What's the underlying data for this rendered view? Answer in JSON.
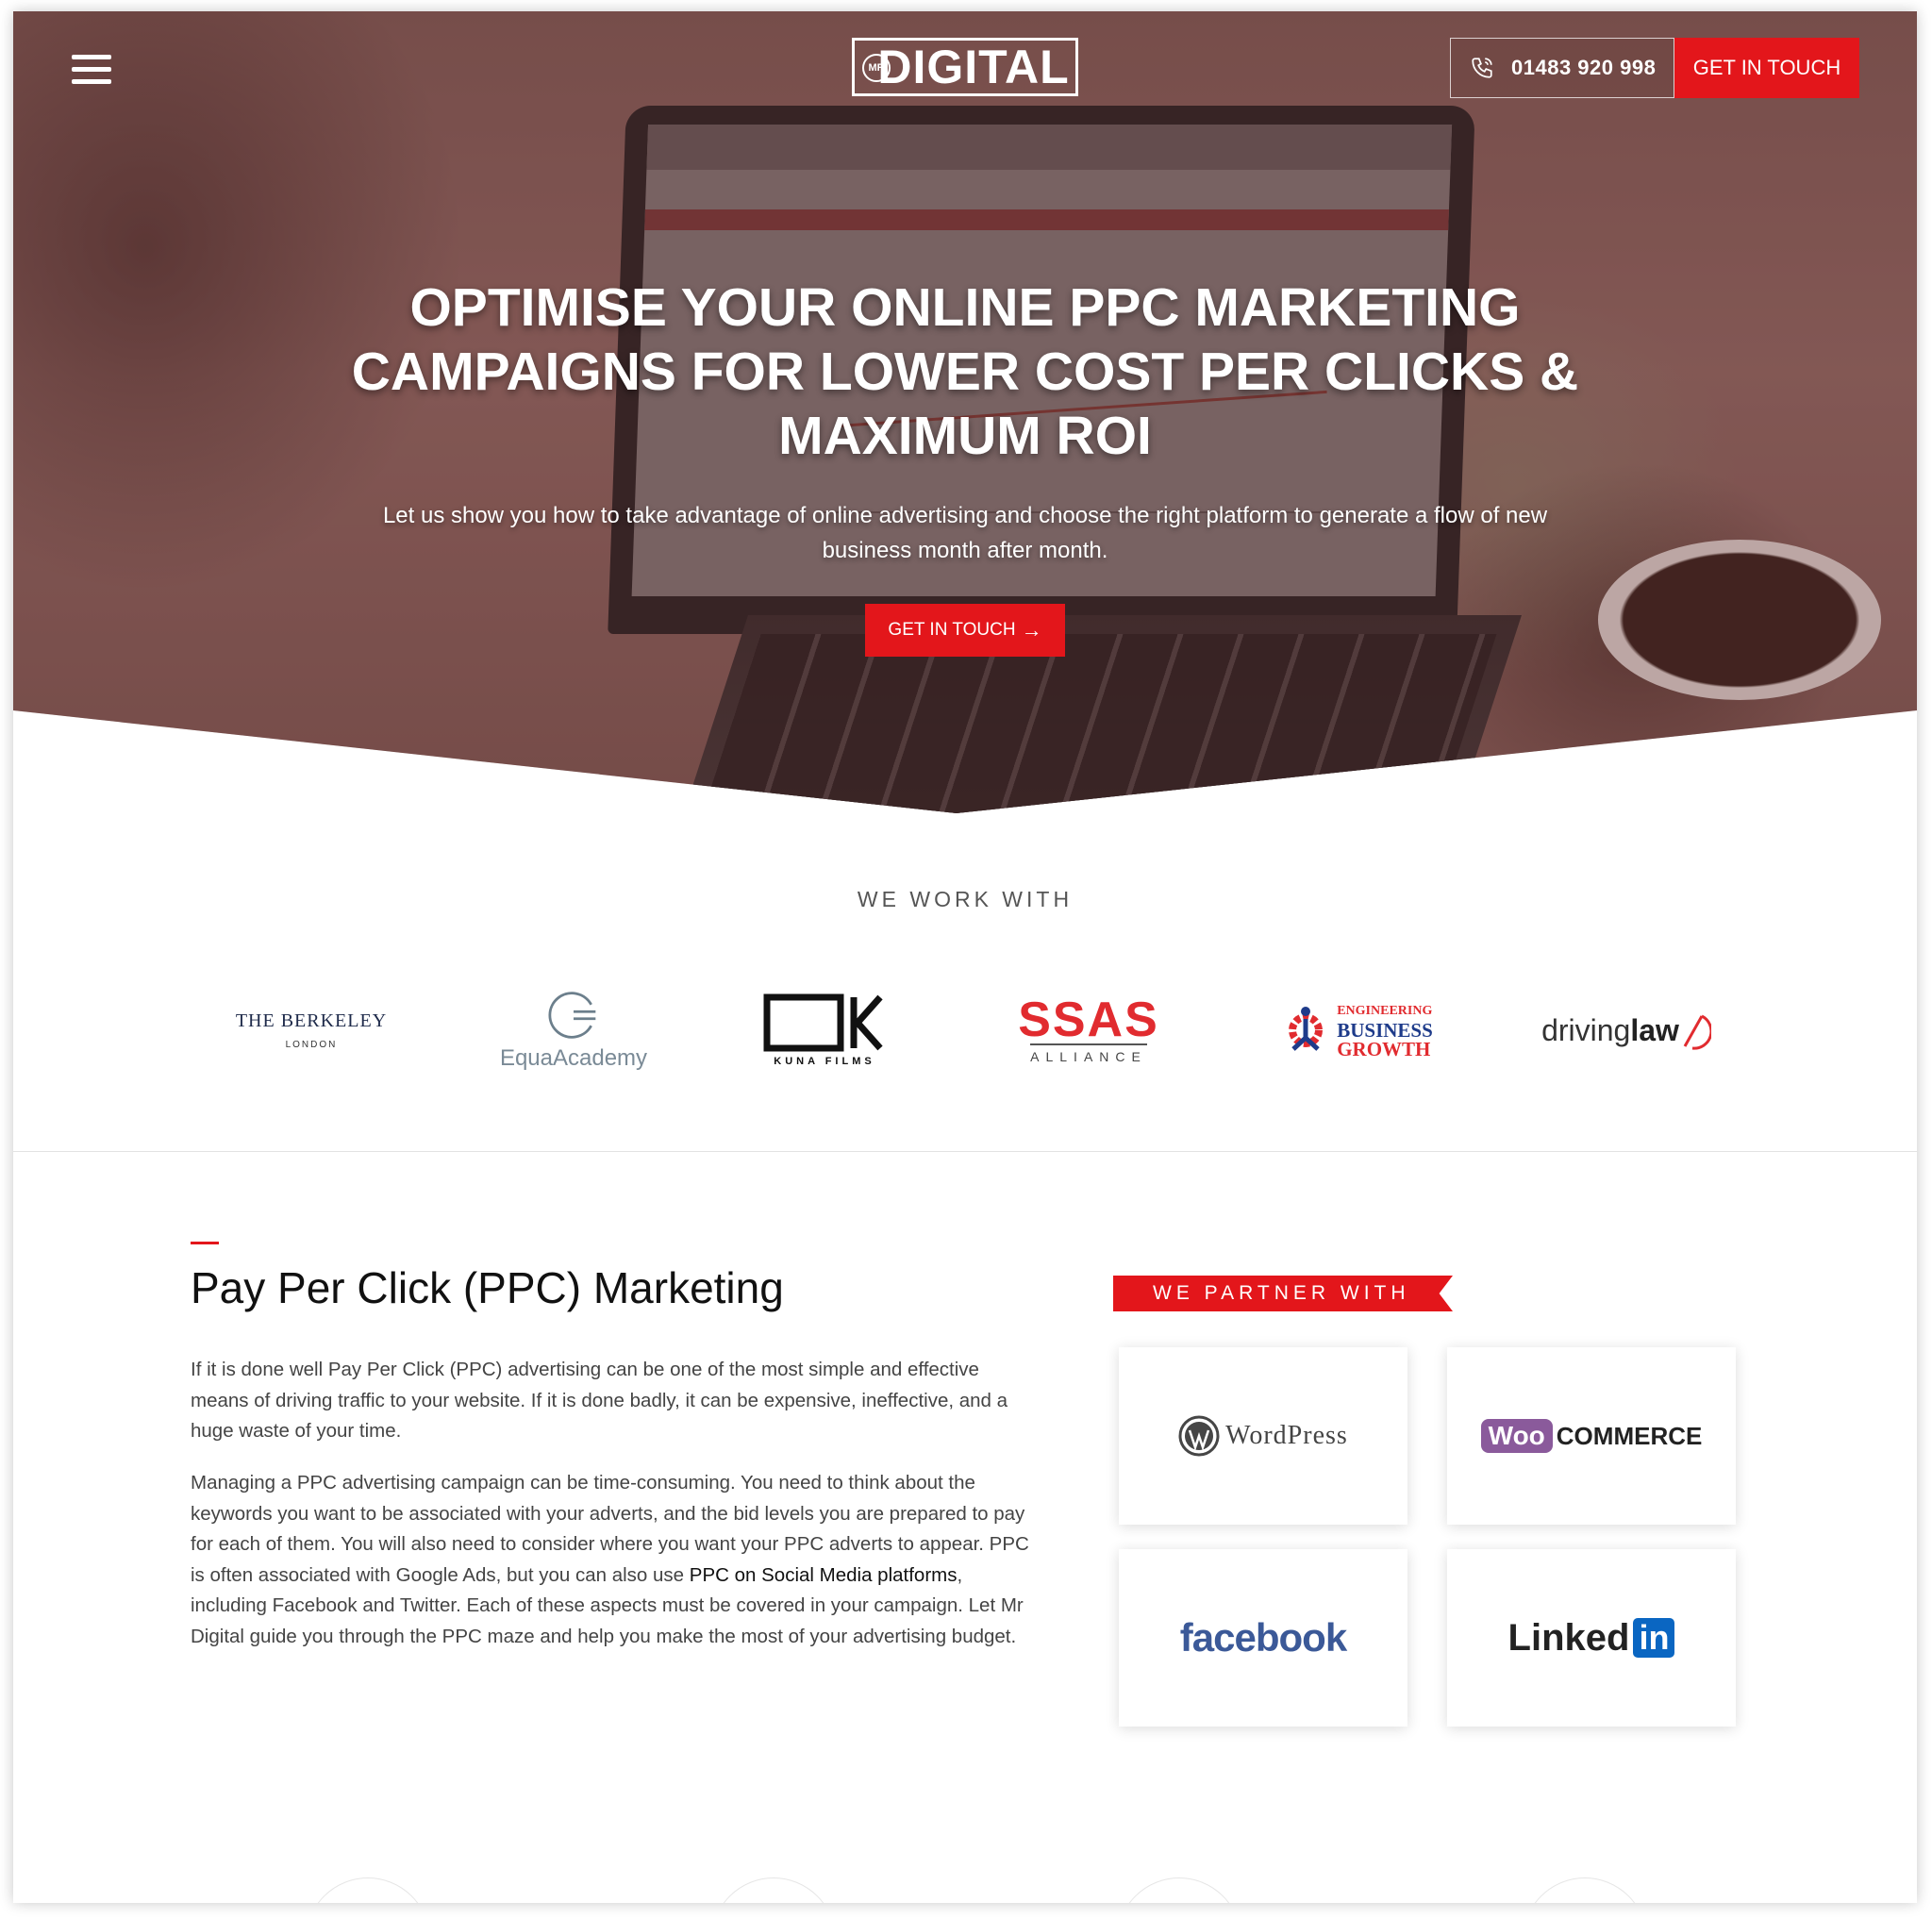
{
  "header": {
    "logo_prefix": "MR",
    "logo_text": "DIGITAL",
    "phone": "01483 920 998",
    "cta_label": "GET IN TOUCH"
  },
  "hero": {
    "title": "OPTIMISE YOUR ONLINE PPC MARKETING CAMPAIGNS FOR LOWER COST PER CLICKS & MAXIMUM ROI",
    "subtitle": "Let us show you how to take advantage of online advertising and choose the right platform to generate a flow of new business month after month.",
    "cta_label": "GET IN TOUCH",
    "cta_arrow": "→"
  },
  "clients": {
    "title": "WE WORK WITH",
    "berkeley": {
      "name": "THE BERKELEY",
      "sub": "LONDON"
    },
    "equa": {
      "name": "EquaAcademy"
    },
    "kuna": {
      "name": "KUNA FILMS"
    },
    "ssas": {
      "name": "SSAS",
      "sub": "ALLIANCE"
    },
    "ebg": {
      "line1": "ENGINEERING",
      "line2": "BUSINESS",
      "line3": "GROWTH"
    },
    "driving": {
      "prefix": "driving",
      "bold": "law"
    }
  },
  "ppc": {
    "title": "Pay Per Click (PPC) Marketing",
    "p1": "If it is done well Pay Per Click (PPC) advertising can be one of the most simple and effective means of driving traffic to your website. If it is done badly, it can be expensive, ineffective, and a huge waste of your time.",
    "p2_before": "Managing a PPC advertising campaign can be time-consuming. You need to think about the keywords you want to be associated with your adverts, and the bid levels you are prepared to pay for each of them. You will also need to consider where you want your PPC adverts to appear. PPC is often associated with Google Ads, but you can also use ",
    "p2_link": "PPC on Social Media platforms",
    "p2_after": ", including Facebook and Twitter. Each of these aspects must be covered in your campaign. Let Mr Digital guide you through the PPC maze and help you make the most of your advertising budget."
  },
  "partners": {
    "title": "WE PARTNER WITH",
    "wordpress": "WordPress",
    "woo_badge": "Woo",
    "woo_text": "COMMERCE",
    "facebook": "facebook",
    "linkedin_text": "Linked",
    "linkedin_in": "in"
  },
  "colors": {
    "accent": "#e3161b"
  }
}
